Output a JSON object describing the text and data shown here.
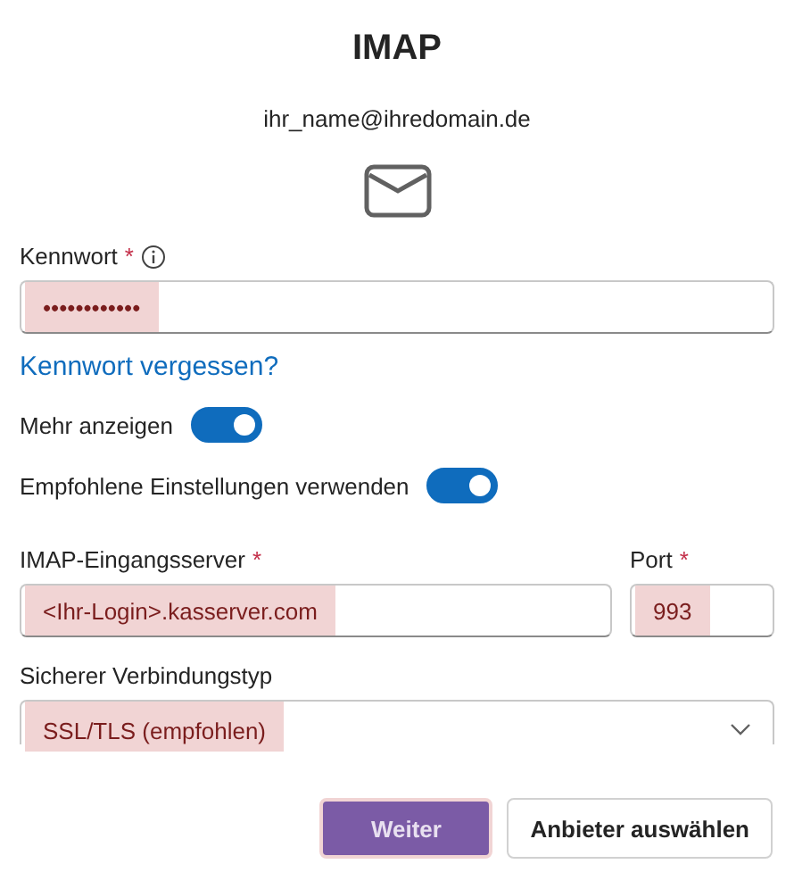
{
  "title": "IMAP",
  "account": "ihr_name@ihredomain.de",
  "password": {
    "label": "Kennwort",
    "required_mark": "*",
    "value": "••••••••••••",
    "highlighted": true
  },
  "forgot_link": "Kennwort vergessen?",
  "toggles": [
    {
      "label": "Mehr anzeigen",
      "on": true
    },
    {
      "label": "Empfohlene Einstellungen verwenden",
      "on": true
    }
  ],
  "server": {
    "label": "IMAP-Eingangsserver",
    "required_mark": "*",
    "value": "<Ihr-Login>.kasserver.com",
    "highlighted": true
  },
  "port": {
    "label": "Port",
    "required_mark": "*",
    "value": "993",
    "highlighted": true
  },
  "security": {
    "label": "Sicherer Verbindungstyp",
    "value": "SSL/TLS (empfohlen)",
    "highlighted": true
  },
  "buttons": [
    {
      "label": "Weiter",
      "kind": "primary"
    },
    {
      "label": "Anbieter auswählen",
      "kind": "secondary"
    }
  ]
}
